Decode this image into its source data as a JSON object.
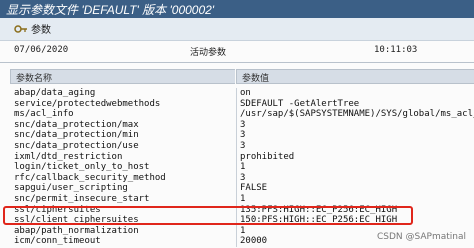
{
  "window": {
    "title": "显示参数文件 'DEFAULT' 版本 '000002'"
  },
  "toolbar": {
    "params_button_label": "参数"
  },
  "header": {
    "date": "07/06/2020",
    "title": "活动参数",
    "time": "10:11:03"
  },
  "table": {
    "columns": [
      "参数名称",
      "参数值"
    ],
    "rows": [
      {
        "name": "abap/data_aging",
        "value": "on"
      },
      {
        "name": "service/protectedwebmethods",
        "value": "SDEFAULT -GetAlertTree"
      },
      {
        "name": "ms/acl_info",
        "value": "/usr/sap/$(SAPSYSTEMNAME)/SYS/global/ms_acl_info"
      },
      {
        "name": "snc/data_protection/max",
        "value": "3"
      },
      {
        "name": "snc/data_protection/min",
        "value": "3"
      },
      {
        "name": "snc/data_protection/use",
        "value": "3"
      },
      {
        "name": "ixml/dtd_restriction",
        "value": "prohibited"
      },
      {
        "name": "login/ticket_only_to_host",
        "value": "1"
      },
      {
        "name": "rfc/callback_security_method",
        "value": "3"
      },
      {
        "name": "sapgui/user_scripting",
        "value": "FALSE"
      },
      {
        "name": "snc/permit_insecure_start",
        "value": "1"
      },
      {
        "name": "ssl/ciphersuites",
        "value": "135:PFS:HIGH::EC_P256:EC_HIGH"
      },
      {
        "name": "ssl/client_ciphersuites",
        "value": "150:PFS:HIGH::EC_P256:EC_HIGH"
      },
      {
        "name": "abap/path_normalization",
        "value": "1"
      },
      {
        "name": "icm/conn_timeout",
        "value": "20000"
      }
    ]
  },
  "highlight_color": "#e0261b",
  "watermark": "CSDN @SAPmatinal"
}
